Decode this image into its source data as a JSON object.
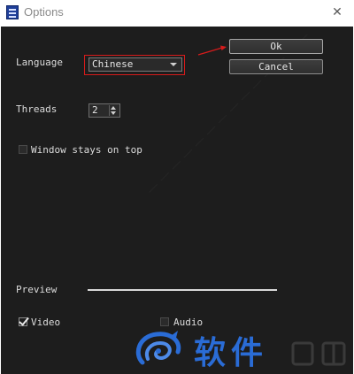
{
  "window": {
    "title": "Options",
    "close_glyph": "✕"
  },
  "buttons": {
    "ok_label": "Ok",
    "cancel_label": "Cancel"
  },
  "language": {
    "label": "Language",
    "selected": "Chinese"
  },
  "threads": {
    "label": "Threads",
    "value": "2"
  },
  "window_on_top": {
    "label": "Window stays on top",
    "checked": false
  },
  "preview": {
    "label": "Preview"
  },
  "video": {
    "label": "Video",
    "checked": true
  },
  "audio": {
    "label": "Audio",
    "checked": false
  },
  "watermark": {
    "brand_text": "软件"
  },
  "icons": {
    "app": "film-icon",
    "close": "close-icon",
    "dropdown": "chevron-down-icon",
    "spinner_up": "spin-up-icon",
    "spinner_down": "spin-down-icon"
  },
  "colors": {
    "client_bg": "#1d1d1d",
    "annotation": "#d71b1b",
    "watermark": "#2a6cd6"
  }
}
